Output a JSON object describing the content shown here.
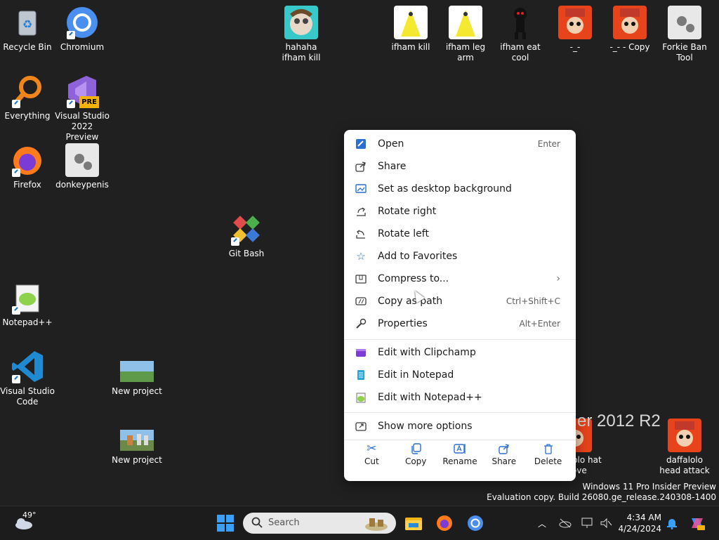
{
  "desktop": {
    "icons": [
      {
        "label": "Recycle Bin"
      },
      {
        "label": "Chromium"
      },
      {
        "label": "Everything"
      },
      {
        "label": "Visual Studio 2022 Preview",
        "badge": "PRE"
      },
      {
        "label": "Firefox"
      },
      {
        "label": "donkeypenis"
      },
      {
        "label": "Git Bash"
      },
      {
        "label": "Notepad++"
      },
      {
        "label": "Visual Studio Code"
      },
      {
        "label": "New project"
      },
      {
        "label": "New project"
      },
      {
        "label": "hahaha ifham kill"
      },
      {
        "label": "ifham kill"
      },
      {
        "label": "ifham leg arm"
      },
      {
        "label": "ifham eat cool"
      },
      {
        "label": "-_-"
      },
      {
        "label": "-_- - Copy"
      },
      {
        "label": "Forkie Ban Tool"
      },
      {
        "label": "daffalolo hat move"
      },
      {
        "label": "daffalolo head attack"
      }
    ]
  },
  "watermark": {
    "big": "er 2012 R2",
    "line1": "Windows 11 Pro Insider Preview",
    "line2": "Evaluation copy. Build 26080.ge_release.240308-1400"
  },
  "context_menu": {
    "items": [
      {
        "label": "Open",
        "shortcut": "Enter",
        "icon": "open-icon"
      },
      {
        "label": "Share",
        "icon": "share-icon"
      },
      {
        "label": "Set as desktop background",
        "icon": "wallpaper-icon"
      },
      {
        "label": "Rotate right",
        "icon": "rotate-right-icon"
      },
      {
        "label": "Rotate left",
        "icon": "rotate-left-icon"
      },
      {
        "label": "Add to Favorites",
        "icon": "star-icon"
      },
      {
        "label": "Compress to...",
        "icon": "zip-icon",
        "submenu": true
      },
      {
        "label": "Copy as path",
        "shortcut": "Ctrl+Shift+C",
        "icon": "copy-path-icon"
      },
      {
        "label": "Properties",
        "shortcut": "Alt+Enter",
        "icon": "wrench-icon"
      }
    ],
    "apps": [
      {
        "label": "Edit with Clipchamp",
        "icon": "clipchamp-icon"
      },
      {
        "label": "Edit in Notepad",
        "icon": "notepad-icon"
      },
      {
        "label": "Edit with Notepad++",
        "icon": "notepadpp-icon"
      }
    ],
    "more": {
      "label": "Show more options",
      "icon": "more-options-icon"
    },
    "bottom_actions": [
      {
        "label": "Cut",
        "icon": "scissors-icon"
      },
      {
        "label": "Copy",
        "icon": "copy-icon"
      },
      {
        "label": "Rename",
        "icon": "rename-icon"
      },
      {
        "label": "Share",
        "icon": "share-icon"
      },
      {
        "label": "Delete",
        "icon": "trash-icon"
      }
    ]
  },
  "taskbar": {
    "weather_temp": "49°",
    "search_placeholder": "Search",
    "time": "4:34 AM",
    "date": "4/24/2024"
  },
  "colors": {
    "desktop_bg": "#202020",
    "accent": "#2b6fd0",
    "menu_bg": "#ffffff"
  }
}
